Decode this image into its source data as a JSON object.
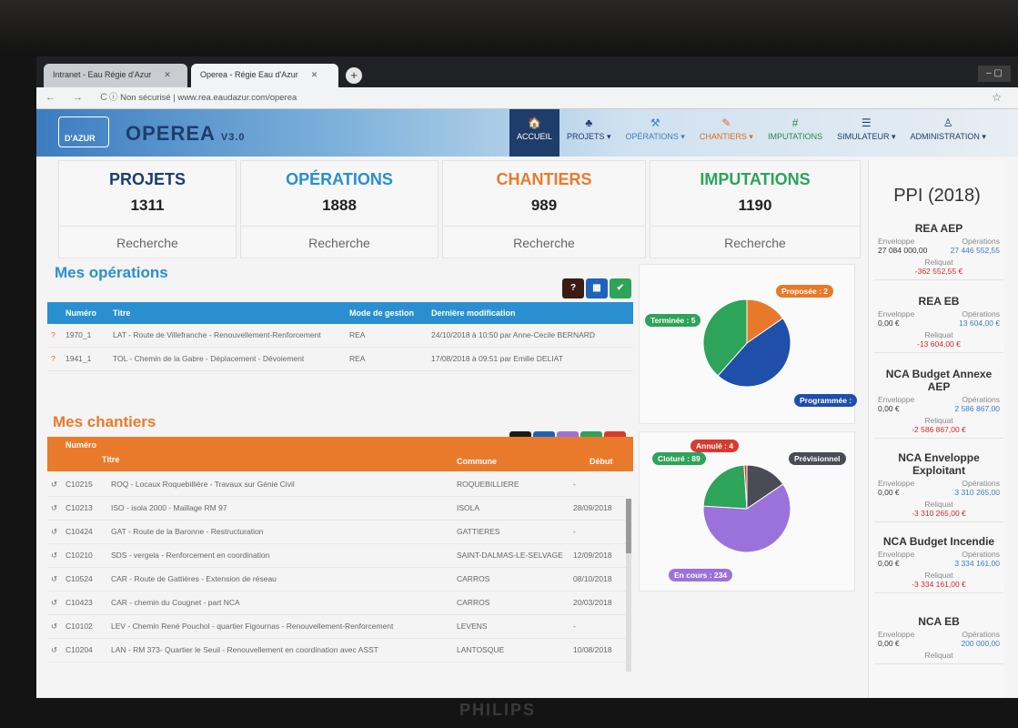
{
  "browser": {
    "tabs": [
      {
        "label": "Intranet - Eau Régie d'Azur"
      },
      {
        "label": "Operea - Régie Eau d'Azur"
      }
    ],
    "new_tab": "+",
    "window_controls": "– ▢",
    "nav": "← → C",
    "url": "ⓘ Non sécurisé | www.rea.eaudazur.com/operea",
    "star": "☆"
  },
  "app": {
    "logo": "D'AZUR",
    "title": "OPEREA",
    "version": "V3.0"
  },
  "menu": [
    {
      "icon": "🏠",
      "label": "ACCUEIL"
    },
    {
      "icon": "♣",
      "label": "PROJETS ▾"
    },
    {
      "icon": "⚒",
      "label": "OPÉRATIONS ▾"
    },
    {
      "icon": "✎",
      "label": "CHANTIERS ▾"
    },
    {
      "icon": "#",
      "label": "IMPUTATIONS"
    },
    {
      "icon": "☰",
      "label": "SIMULATEUR ▾"
    },
    {
      "icon": "♙",
      "label": "ADMINISTRATION ▾"
    }
  ],
  "stats": {
    "projets": {
      "title": "PROJETS",
      "count": "1311",
      "search": "Recherche"
    },
    "operations": {
      "title": "OPÉRATIONS",
      "count": "1888",
      "search": "Recherche"
    },
    "chantiers": {
      "title": "CHANTIERS",
      "count": "989",
      "search": "Recherche"
    },
    "imputations": {
      "title": "IMPUTATIONS",
      "count": "1190",
      "search": "Recherche"
    }
  },
  "colors": {
    "blue": "#2a8fd0",
    "orange": "#ea7a2b",
    "green": "#2ea35a",
    "navy": "#1e3d6b"
  },
  "mes_operations": {
    "title": "Mes opérations",
    "buttons": [
      "?",
      "▦",
      "✔"
    ],
    "headers": {
      "numero": "Numéro",
      "titre": "Titre",
      "mode": "Mode de gestion",
      "modif": "Dernière modification"
    },
    "rows": [
      {
        "mark": "?",
        "numero": "1970_1",
        "titre": "LAT - Route de Villefranche - Renouvellement-Renforcement",
        "mode": "REA",
        "modif": "24/10/2018 à 10:50 par Anne-Cecile BERNARD"
      },
      {
        "mark": "?",
        "numero": "1941_1",
        "titre": "TOL - Chemin de la Gabre - Déplacement - Dévoiement",
        "mode": "REA",
        "modif": "17/08/2018 à 09:51 par Emilie DELIAT"
      }
    ]
  },
  "mes_chantiers": {
    "title": "Mes chantiers",
    "buttons": [
      "↺",
      "▦",
      "○",
      "✔",
      "✖"
    ],
    "headers": {
      "numero": "Numéro",
      "titre": "Titre",
      "commune": "Commune",
      "debut": "Début"
    },
    "rows": [
      {
        "mark": "↺",
        "numero": "C10215",
        "titre": "ROQ - Locaux Roquebillière - Travaux sur Génie Civil",
        "commune": "ROQUEBILLIERE",
        "debut": "-"
      },
      {
        "mark": "↺",
        "numero": "C10213",
        "titre": "ISO - isola 2000 - Maillage RM 97",
        "commune": "ISOLA",
        "debut": "28/09/2018"
      },
      {
        "mark": "↺",
        "numero": "C10424",
        "titre": "GAT - Route de la Baronne - Restructuration",
        "commune": "GATTIERES",
        "debut": "-"
      },
      {
        "mark": "↺",
        "numero": "C10210",
        "titre": "SDS - vergela - Renforcement en coordination",
        "commune": "SAINT-DALMAS-LE-SELVAGE",
        "debut": "12/09/2018"
      },
      {
        "mark": "↺",
        "numero": "C10524",
        "titre": "CAR - Route de Gattières - Extension de réseau",
        "commune": "CARROS",
        "debut": "08/10/2018"
      },
      {
        "mark": "↺",
        "numero": "C10423",
        "titre": "CAR - chemin du Cougnet - part NCA",
        "commune": "CARROS",
        "debut": "20/03/2018"
      },
      {
        "mark": "↺",
        "numero": "C10102",
        "titre": "LEV - Chemin René Pouchol - quartier Figournas - Renouvellement-Renforcement",
        "commune": "LEVENS",
        "debut": "-"
      },
      {
        "mark": "↺",
        "numero": "C10204",
        "titre": "LAN - RM 373- Quartier le Seuil - Renouvellement en coordination avec ASST",
        "commune": "LANTOSQUE",
        "debut": "10/08/2018"
      }
    ]
  },
  "pie_operations": {
    "slices": [
      {
        "label": "Proposée : 2",
        "value": 2,
        "color": "#e8792a"
      },
      {
        "label": "Programmée :",
        "value": 6,
        "color": "#1f4fa8"
      },
      {
        "label": "Terminée : 5",
        "value": 5,
        "color": "#2ea35a"
      }
    ]
  },
  "pie_chantiers": {
    "slices": [
      {
        "label": "Prévisionnel",
        "value": 60,
        "color": "#4a4c55"
      },
      {
        "label": "En cours : 234",
        "value": 234,
        "color": "#9b72d9"
      },
      {
        "label": "Cloturé : 89",
        "value": 89,
        "color": "#2ea35a"
      },
      {
        "label": "Annulé : 4",
        "value": 4,
        "color": "#d93a2f"
      }
    ]
  },
  "ppi": {
    "title": "PPI (2018)",
    "env_label": "Enveloppe",
    "ops_label": "Opérations",
    "rel_label": "Reliquat",
    "cards": [
      {
        "name": "REA AEP",
        "enveloppe": "27 084 000,00",
        "operations": "27 446 552,55",
        "reliquat": "-362 552,55 €"
      },
      {
        "name": "REA EB",
        "enveloppe": "0,00 €",
        "operations": "13 604,00 €",
        "reliquat": "-13 604,00 €"
      },
      {
        "name": "NCA Budget Annexe AEP",
        "enveloppe": "0,00 €",
        "operations": "2 586 867,00",
        "reliquat": "-2 586 867,00 €"
      },
      {
        "name": "NCA Enveloppe Exploitant",
        "enveloppe": "0,00 €",
        "operations": "3 310 265,00",
        "reliquat": "-3 310 265,00 €"
      },
      {
        "name": "NCA Budget Incendie",
        "enveloppe": "0,00 €",
        "operations": "3 334 161,00",
        "reliquat": "-3 334 161,00 €"
      },
      {
        "name": "NCA EB",
        "enveloppe": "0,00 €",
        "operations": "200 000,00",
        "reliquat": ""
      }
    ]
  },
  "monitor_brand": "PHILIPS"
}
